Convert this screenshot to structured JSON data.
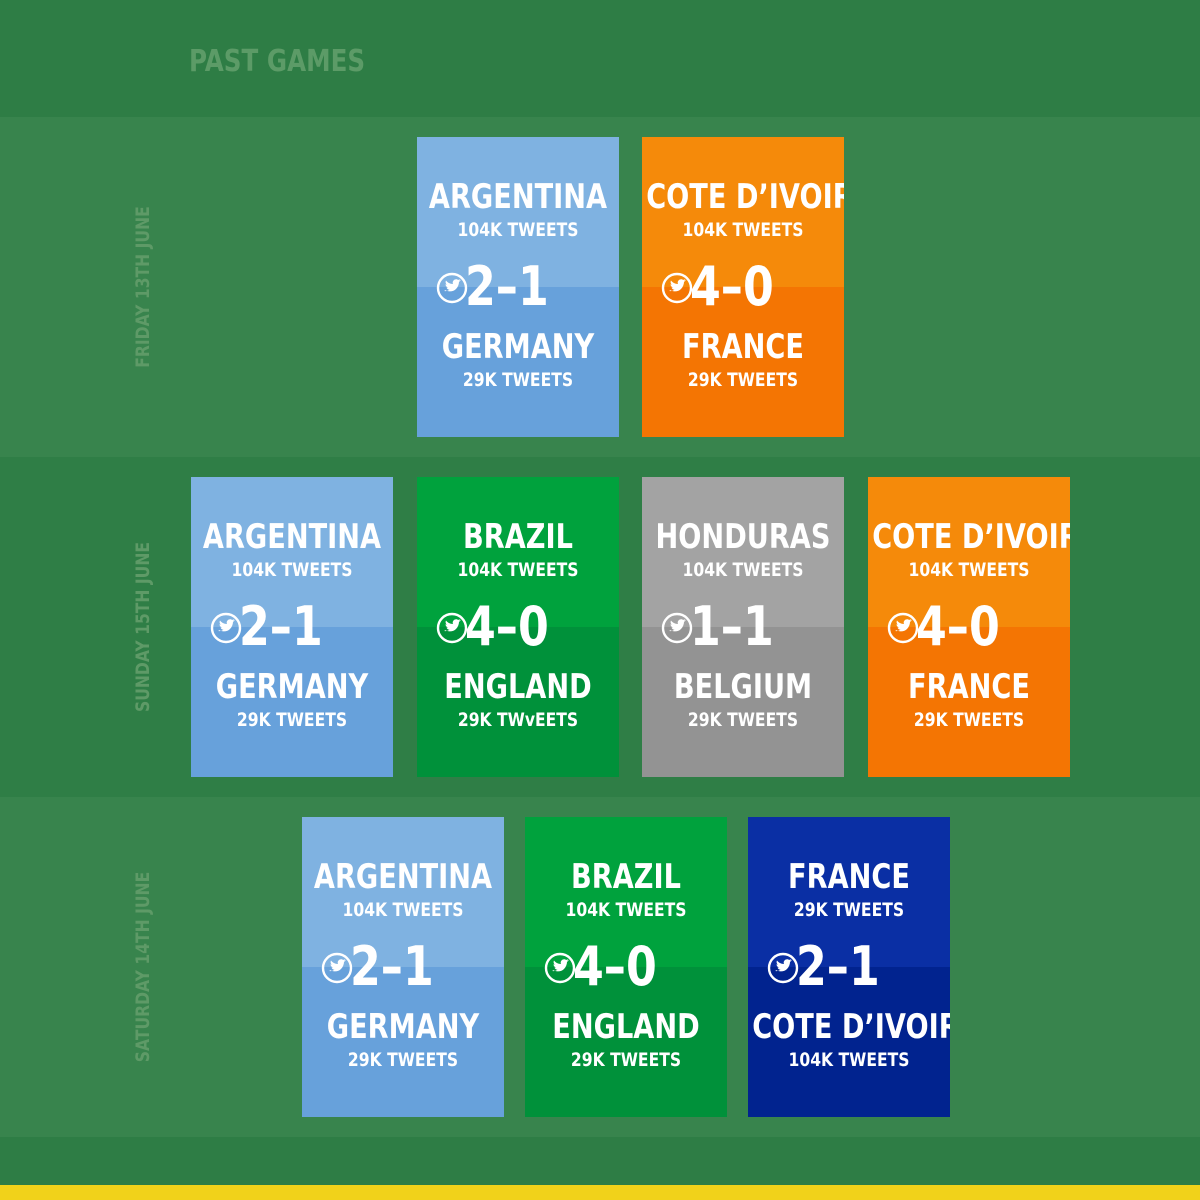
{
  "header": {
    "title": "PAST GAMES"
  },
  "days": [
    {
      "label": "FRIDAY 13TH JUNE",
      "matches": [
        {
          "team_a": "ARGENTINA",
          "tweets_a": "104K TWEETS",
          "score": "2–1",
          "team_b": "GERMANY",
          "tweets_b": "29K TWEETS",
          "theme": "blue"
        },
        {
          "team_a": "COTE D’IVOIRE",
          "tweets_a": "104K TWEETS",
          "score": "4–0",
          "team_b": "FRANCE",
          "tweets_b": "29K TWEETS",
          "theme": "orange"
        }
      ]
    },
    {
      "label": "SUNDAY 15TH JUNE",
      "matches": [
        {
          "team_a": "ARGENTINA",
          "tweets_a": "104K TWEETS",
          "score": "2–1",
          "team_b": "GERMANY",
          "tweets_b": "29K TWEETS",
          "theme": "blue"
        },
        {
          "team_a": "BRAZIL",
          "tweets_a": "104K TWEETS",
          "score": "4–0",
          "team_b": "ENGLAND",
          "tweets_b": "29K TWvEETS",
          "theme": "green"
        },
        {
          "team_a": "HONDURAS",
          "tweets_a": "104K TWEETS",
          "score": "1–1",
          "team_b": "BELGIUM",
          "tweets_b": "29K TWEETS",
          "theme": "gray"
        },
        {
          "team_a": "COTE D’IVOIRE",
          "tweets_a": "104K TWEETS",
          "score": "4–0",
          "team_b": "FRANCE",
          "tweets_b": "29K TWEETS",
          "theme": "orange"
        }
      ]
    },
    {
      "label": "SATURDAY 14TH JUNE",
      "matches": [
        {
          "team_a": "ARGENTINA",
          "tweets_a": "104K TWEETS",
          "score": "2–1",
          "team_b": "GERMANY",
          "tweets_b": "29K TWEETS",
          "theme": "blue"
        },
        {
          "team_a": "BRAZIL",
          "tweets_a": "104K TWEETS",
          "score": "4–0",
          "team_b": "ENGLAND",
          "tweets_b": "29K TWEETS",
          "theme": "green"
        },
        {
          "team_a": "FRANCE",
          "tweets_a": "29K TWEETS",
          "score": "2–1",
          "team_b": "COTE D’IVOIRE",
          "tweets_b": "104K TWEETS",
          "theme": "navy"
        }
      ]
    }
  ],
  "icons": {
    "score_icon": "twitter-bird-icon"
  },
  "colors": {
    "background": "#34814a",
    "accent_bar": "#f1d21a",
    "blue": "#7fb2e1",
    "orange": "#f58a0a",
    "green": "#00a23d",
    "gray": "#a3a3a3",
    "navy": "#0a2fa4"
  }
}
